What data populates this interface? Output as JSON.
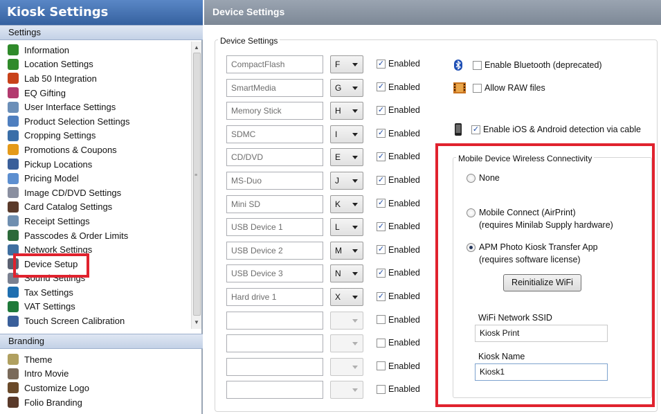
{
  "sidebar": {
    "title": "Kiosk Settings",
    "settings_header": "Settings",
    "settings_items": [
      {
        "label": "Information",
        "icon": "info-icon",
        "color": "#2f8a2a"
      },
      {
        "label": "Location Settings",
        "icon": "info-icon",
        "color": "#2f8a2a"
      },
      {
        "label": "Lab 50 Integration",
        "icon": "lab50-icon",
        "color": "#c8421a"
      },
      {
        "label": "EQ Gifting",
        "icon": "gift-icon",
        "color": "#b23a6e"
      },
      {
        "label": "User Interface Settings",
        "icon": "window-icon",
        "color": "#6b8fb8"
      },
      {
        "label": "Product Selection Settings",
        "icon": "products-icon",
        "color": "#4f7fbf"
      },
      {
        "label": "Cropping Settings",
        "icon": "crop-icon",
        "color": "#3a6ea8"
      },
      {
        "label": "Promotions & Coupons",
        "icon": "coupon-icon",
        "color": "#e49a1a"
      },
      {
        "label": "Pickup Locations",
        "icon": "pin-icon",
        "color": "#3a5f9a"
      },
      {
        "label": "Pricing Model",
        "icon": "tag-icon",
        "color": "#5d8fd0"
      },
      {
        "label": "Image CD/DVD Settings",
        "icon": "disc-icon",
        "color": "#8a8fa0"
      },
      {
        "label": "Card Catalog Settings",
        "icon": "catalog-icon",
        "color": "#5a3a2a"
      },
      {
        "label": "Receipt Settings",
        "icon": "receipt-icon",
        "color": "#6f8fb0"
      },
      {
        "label": "Passcodes & Order Limits",
        "icon": "dollar-icon",
        "color": "#2c6a3a"
      },
      {
        "label": "Network Settings",
        "icon": "network-icon",
        "color": "#3f6fa0"
      },
      {
        "label": "Device Setup",
        "icon": "device-icon",
        "color": "#5a6070"
      },
      {
        "label": "Sound Settings",
        "icon": "speaker-icon",
        "color": "#7a8090"
      },
      {
        "label": "Tax Settings",
        "icon": "tax-icon",
        "color": "#1f6fb0"
      },
      {
        "label": "VAT Settings",
        "icon": "vat-icon",
        "color": "#1f7a3a"
      },
      {
        "label": "Touch Screen Calibration",
        "icon": "touch-icon",
        "color": "#3a5f9a"
      }
    ],
    "branding_header": "Branding",
    "branding_items": [
      {
        "label": "Theme",
        "icon": "palette-icon",
        "color": "#b0a060"
      },
      {
        "label": "Intro Movie",
        "icon": "movie-icon",
        "color": "#7a6a5a"
      },
      {
        "label": "Customize Logo",
        "icon": "hammer-icon",
        "color": "#6a4a2a"
      },
      {
        "label": "Folio Branding",
        "icon": "catalog-icon",
        "color": "#5a3a2a"
      }
    ]
  },
  "main": {
    "title": "Device Settings",
    "group_title": "Device Settings",
    "enabled_label": "Enabled",
    "devices": [
      {
        "name": "CompactFlash",
        "drive": "F",
        "enabled": true
      },
      {
        "name": "SmartMedia",
        "drive": "G",
        "enabled": true
      },
      {
        "name": "Memory Stick",
        "drive": "H",
        "enabled": true
      },
      {
        "name": "SDMC",
        "drive": "I",
        "enabled": true
      },
      {
        "name": "CD/DVD",
        "drive": "E",
        "enabled": true
      },
      {
        "name": "MS-Duo",
        "drive": "J",
        "enabled": true
      },
      {
        "name": "Mini SD",
        "drive": "K",
        "enabled": true
      },
      {
        "name": "USB Device 1",
        "drive": "L",
        "enabled": true
      },
      {
        "name": "USB Device 2",
        "drive": "M",
        "enabled": true
      },
      {
        "name": "USB Device 3",
        "drive": "N",
        "enabled": true
      },
      {
        "name": "Hard drive 1",
        "drive": "X",
        "enabled": true
      },
      {
        "name": "",
        "drive": "",
        "enabled": false
      },
      {
        "name": "",
        "drive": "",
        "enabled": false
      },
      {
        "name": "",
        "drive": "",
        "enabled": false
      },
      {
        "name": "",
        "drive": "",
        "enabled": false
      }
    ],
    "options": {
      "bluetooth_label": "Enable Bluetooth (deprecated)",
      "bluetooth_checked": false,
      "raw_label": "Allow RAW files",
      "raw_checked": false,
      "ios_label": "Enable iOS & Android detection via cable",
      "ios_checked": true
    },
    "wireless": {
      "group_title": "Mobile Device Wireless Connectivity",
      "radio_none": "None",
      "radio_mobile_connect": "Mobile Connect (AirPrint)",
      "radio_mobile_connect_note": "(requires Minilab Supply hardware)",
      "radio_apm": "APM Photo Kiosk Transfer App",
      "radio_apm_note": "(requires software license)",
      "selected": "apm",
      "reinit_button": "Reinitialize WiFi",
      "ssid_label": "WiFi Network SSID",
      "ssid_value": "Kiosk Print",
      "kiosk_name_label": "Kiosk Name",
      "kiosk_name_value": "Kiosk1"
    }
  }
}
